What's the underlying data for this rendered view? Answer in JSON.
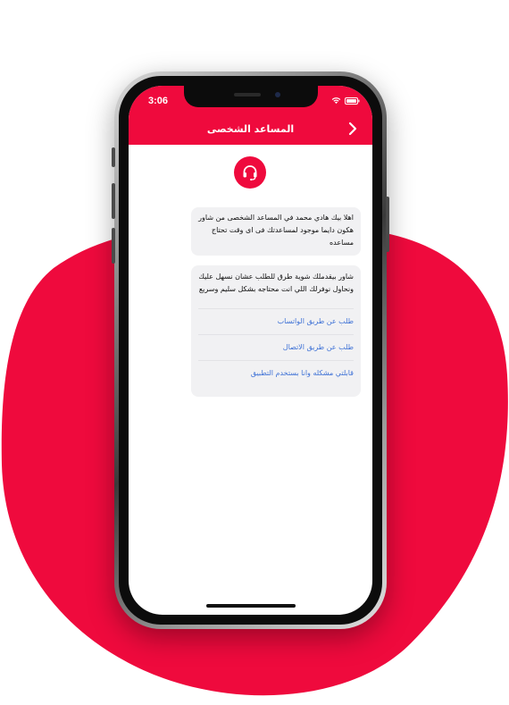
{
  "status_bar": {
    "time": "3:06"
  },
  "header": {
    "title": "المساعد الشخصى"
  },
  "chat": {
    "avatar_icon": "headset-icon",
    "messages": [
      {
        "text": "اهلا بيك هادي محمد في المساعد الشخصى من شاور هكون دايما موجود لمساعدتك فى اى وقت تحتاج مساعده"
      },
      {
        "text": "شاور بيقدملك شوية طرق للطلب عشان نسهل عليك ونحاول نوفرلك اللي انت محتاجه بشكل سليم وسريع"
      }
    ],
    "options": [
      {
        "label": "طلب عن طريق الواتساب"
      },
      {
        "label": "طلب عن طريق الاتصال"
      },
      {
        "label": "قابلتي مشكله وانا بستخدم التطبيق"
      }
    ]
  },
  "colors": {
    "accent": "#ef0a3d",
    "link": "#3f72d6",
    "bubble": "#f1f1f3"
  }
}
